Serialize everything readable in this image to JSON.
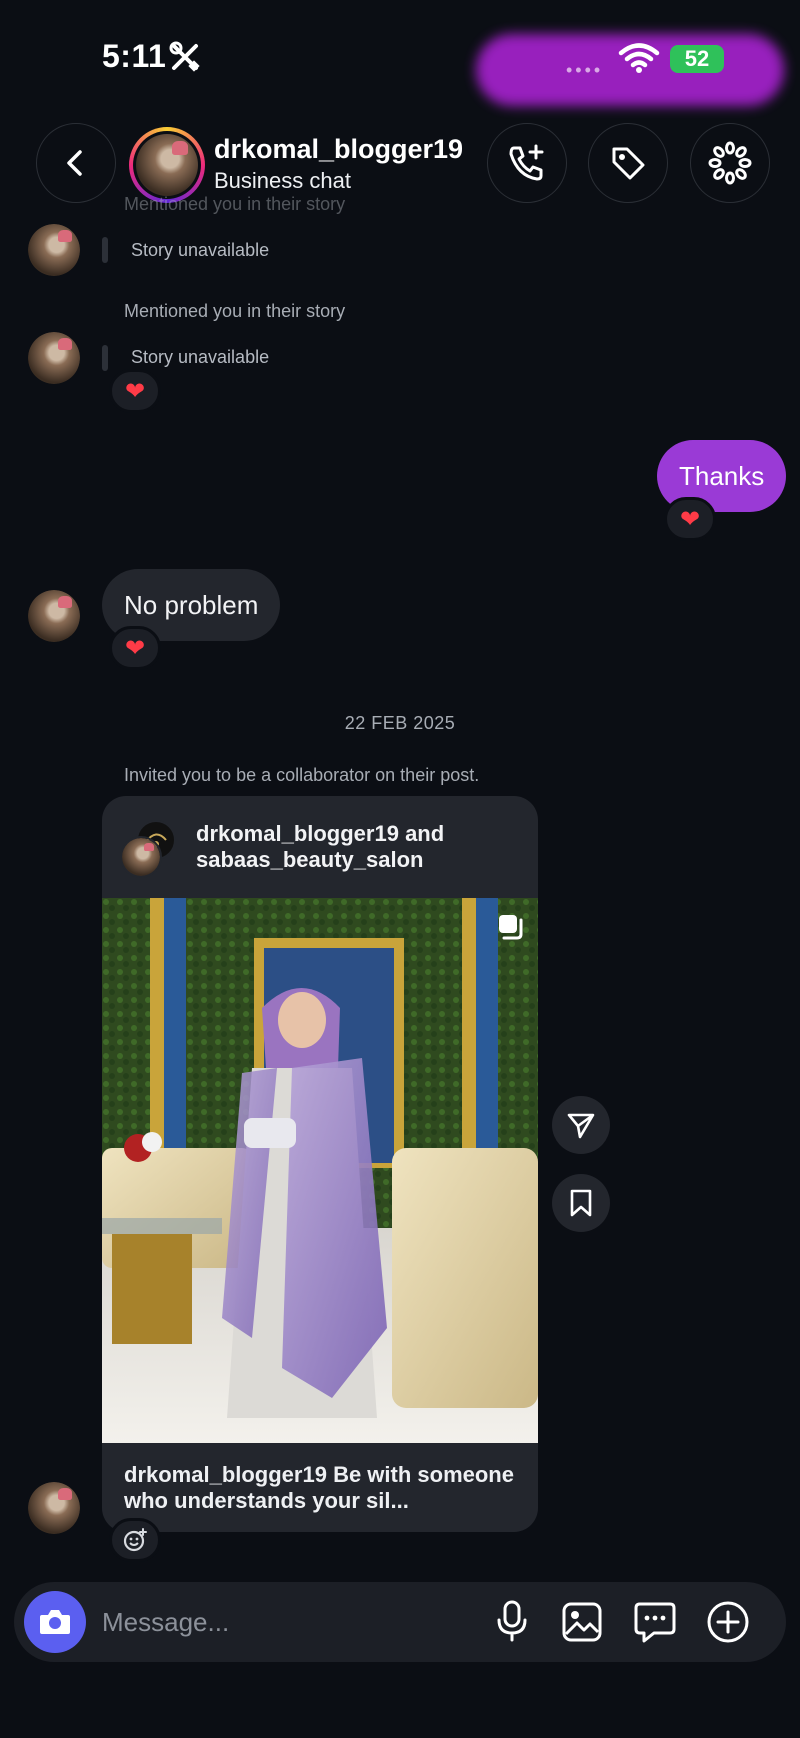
{
  "status_bar": {
    "time": "5:11",
    "battery": "52"
  },
  "header": {
    "username": "drkomal_blogger19",
    "subtitle": "Business chat",
    "icons": [
      "back-icon",
      "call-add-icon",
      "tag-icon",
      "effects-icon"
    ]
  },
  "messages": {
    "faded_mention": "Mentioned you in their story",
    "story_unavailable_1": "Story unavailable",
    "mention_2": "Mentioned you in their story",
    "story_unavailable_2": "Story unavailable",
    "heart": "❤",
    "me_thanks": "Thanks",
    "them_no_problem": "No problem",
    "date": "22 FEB 2025",
    "collab_invite": "Invited you to be a collaborator on their post."
  },
  "post_card": {
    "title": "drkomal_blogger19 and sabaas_beauty_salon",
    "caption": "drkomal_blogger19 Be with someone who understands your sil..."
  },
  "composer": {
    "placeholder": "Message..."
  },
  "colors": {
    "background": "#0b0e14",
    "my_bubble": "#9a3ad6",
    "their_bubble": "#23262d",
    "camera_button": "#5b5ff0"
  }
}
